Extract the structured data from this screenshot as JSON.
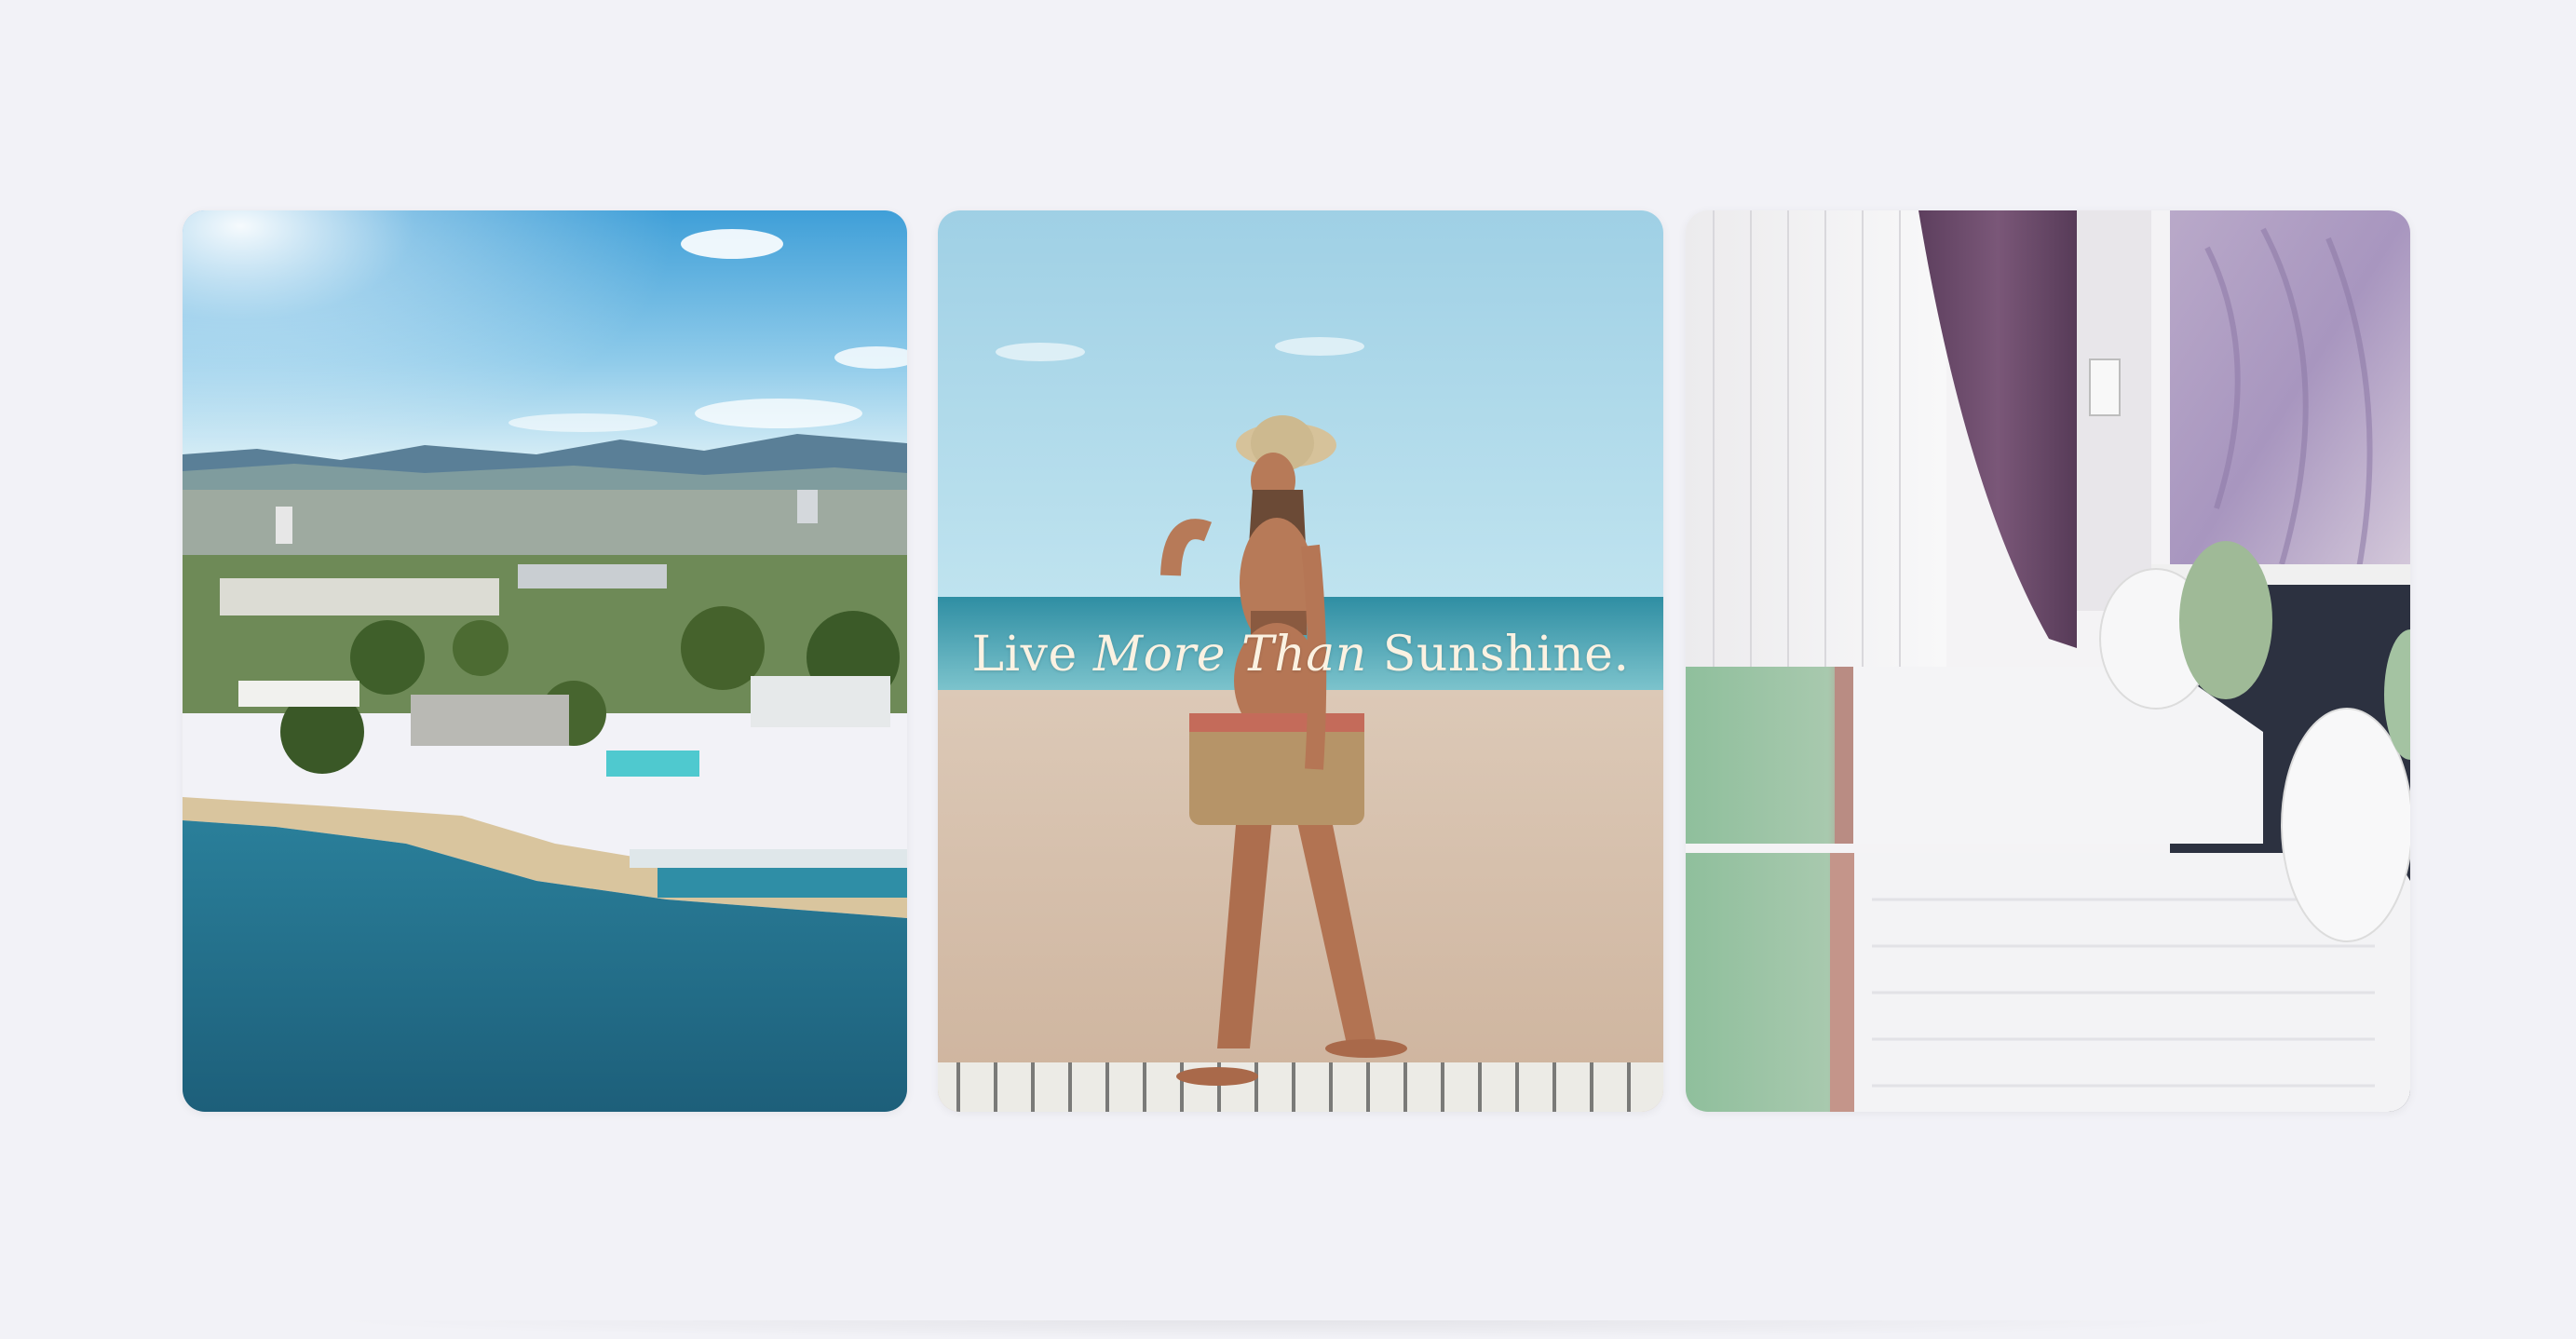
{
  "gallery": {
    "cards": [
      {
        "image": "aerial-coastal-resort-photo"
      },
      {
        "image": "woman-walking-on-beach-photo",
        "tagline": {
          "part1": "Live ",
          "part2": "More",
          "part3": " ",
          "part4": "Than",
          "part5": " Sunshine."
        }
      },
      {
        "image": "hotel-twin-bedroom-photo"
      }
    ]
  },
  "colors": {
    "page_background": "#f2f2f7",
    "tagline_text": "#fbf2e2"
  }
}
